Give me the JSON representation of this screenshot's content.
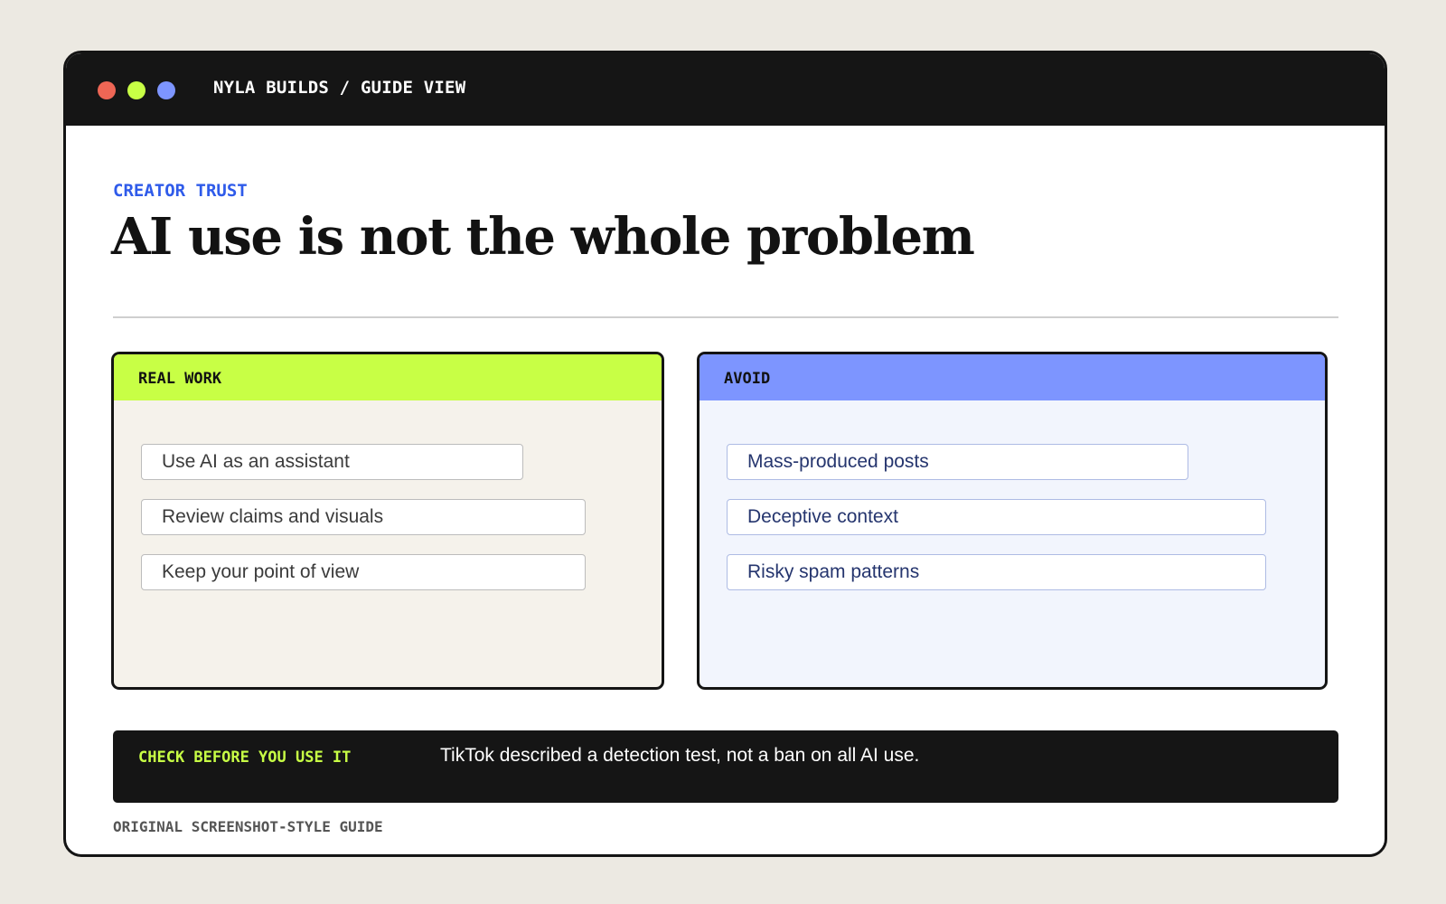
{
  "window": {
    "title": "NYLA BUILDS / GUIDE VIEW",
    "controls": [
      {
        "icon": "close-dot-icon",
        "color": "#ee6655"
      },
      {
        "icon": "minimize-dot-icon",
        "color": "#c8ff45"
      },
      {
        "icon": "maximize-dot-icon",
        "color": "#7d95ff"
      }
    ]
  },
  "header": {
    "eyebrow": "CREATOR TRUST",
    "headline": "AI use is not the whole problem"
  },
  "panels": {
    "real_work": {
      "label": "REAL WORK",
      "accent": "#c8ff45",
      "items": [
        "Use AI as an assistant",
        "Review claims and visuals",
        "Keep your point of view"
      ]
    },
    "avoid": {
      "label": "AVOID",
      "accent": "#7d95ff",
      "items": [
        "Mass-produced posts",
        "Deceptive context",
        "Risky spam patterns"
      ]
    }
  },
  "callout": {
    "label": "CHECK BEFORE YOU USE IT",
    "text": "TikTok described a detection test, not a ban on all AI use."
  },
  "footer": {
    "note": "ORIGINAL SCREENSHOT-STYLE GUIDE"
  },
  "colors": {
    "page_background": "#ece9e2",
    "titlebar": "#151515",
    "eyebrow": "#2f5bea",
    "lime": "#c8ff45",
    "periwinkle": "#7d95ff"
  }
}
